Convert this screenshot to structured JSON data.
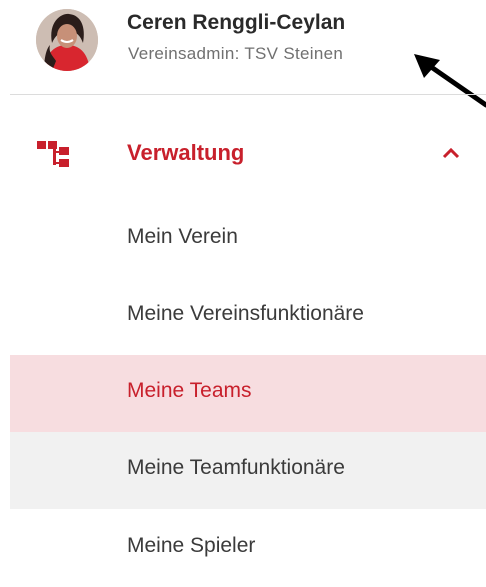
{
  "user": {
    "name": "Ceren Renggli-Ceylan",
    "role": "Vereinsadmin: TSV Steinen"
  },
  "nav": {
    "section": {
      "label": "Verwaltung",
      "icon": "org-chart-icon",
      "expanded": true,
      "color": "#c8202c"
    },
    "items": [
      {
        "label": "Mein Verein"
      },
      {
        "label": "Meine Vereinsfunktionäre"
      },
      {
        "label": "Meine Teams",
        "state": "active"
      },
      {
        "label": "Meine Teamfunktionäre",
        "state": "hover"
      },
      {
        "label": "Meine Spieler"
      }
    ]
  },
  "colors": {
    "accent": "#c8202c",
    "active_bg": "#f7dde0",
    "hover_bg": "#f1f1f1",
    "text": "#3b3b3b"
  }
}
